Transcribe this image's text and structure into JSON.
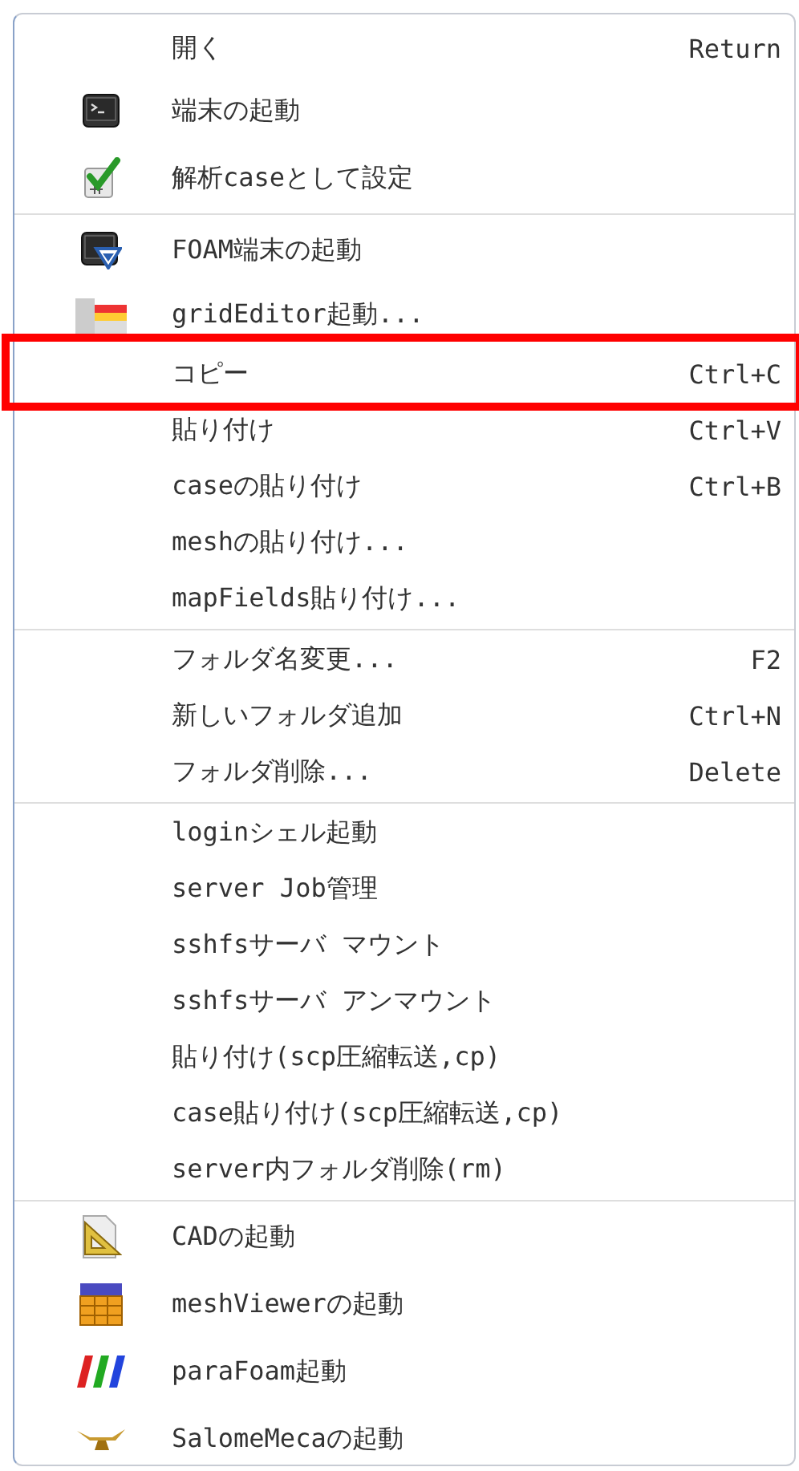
{
  "menu": {
    "sections": [
      {
        "items": [
          {
            "label": "開く",
            "shortcut": "Return",
            "highlighted": false
          },
          {
            "label": "端末の起動",
            "kind": "terminal",
            "highlighted": false
          },
          {
            "label": "解析caseとして設定",
            "kind": "check",
            "highlighted": false
          }
        ]
      },
      {
        "items": [
          {
            "label": "FOAM端末の起動",
            "kind": "foam-terminal",
            "highlighted": false
          },
          {
            "label": "gridEditor起動...",
            "kind": "grid",
            "highlighted": false
          },
          {
            "label": "コピー",
            "shortcut": "Ctrl+C",
            "highlighted": true
          },
          {
            "label": "貼り付け",
            "shortcut": "Ctrl+V",
            "highlighted": false
          },
          {
            "label": "caseの貼り付け",
            "shortcut": "Ctrl+B",
            "highlighted": false
          },
          {
            "label": "meshの貼り付け...",
            "highlighted": false
          },
          {
            "label": "mapFields貼り付け...",
            "highlighted": false
          }
        ]
      },
      {
        "items": [
          {
            "label": "フォルダ名変更...",
            "shortcut": "F2",
            "highlighted": false
          },
          {
            "label": "新しいフォルダ追加",
            "shortcut": "Ctrl+N",
            "highlighted": false
          },
          {
            "label": "フォルダ削除...",
            "shortcut": "Delete",
            "highlighted": false
          }
        ]
      },
      {
        "items": [
          {
            "label": "loginシェル起動",
            "highlighted": false
          },
          {
            "label": "server Job管理",
            "highlighted": false
          },
          {
            "label": "sshfsサーバ マウント",
            "highlighted": false
          },
          {
            "label": "sshfsサーバ アンマウント",
            "highlighted": false
          },
          {
            "label": "貼り付け(scp圧縮転送,cp)",
            "highlighted": false
          },
          {
            "label": "case貼り付け(scp圧縮転送,cp)",
            "highlighted": false
          },
          {
            "label": "server内フォルダ削除(rm)",
            "highlighted": false
          }
        ]
      },
      {
        "items": [
          {
            "label": "CADの起動",
            "kind": "cad",
            "highlighted": false
          },
          {
            "label": "meshViewerの起動",
            "kind": "vtk",
            "highlighted": false
          },
          {
            "label": "paraFoam起動",
            "kind": "bars",
            "highlighted": false
          },
          {
            "label": "SalomeMecaの起動",
            "kind": "lamp",
            "highlighted": false
          }
        ]
      }
    ]
  }
}
